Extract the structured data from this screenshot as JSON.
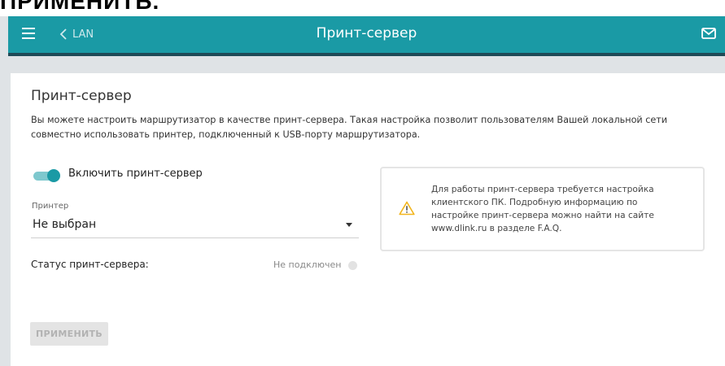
{
  "top_strip": {
    "text": "ПРИМЕНИТЬ."
  },
  "header": {
    "back_label": "LAN",
    "title": "Принт-сервер"
  },
  "page": {
    "title": "Принт-сервер",
    "description": "Вы можете настроить маршрутизатор в качестве принт-сервера. Такая настройка позволит пользователям Вашей локальной сети совместно использовать принтер, подключенный к USB-порту маршрутизатора."
  },
  "toggle": {
    "label": "Включить принт-сервер",
    "enabled": true
  },
  "printer": {
    "label": "Принтер",
    "selected": "Не выбран"
  },
  "status": {
    "label": "Статус принт-сервера:",
    "value": "Не подключен"
  },
  "info": {
    "text": "Для работы принт-сервера требуется настройка клиентского ПК. Подробную информацию по настройке принт-сервера можно найти на сайте www.dlink.ru в разделе F.A.Q."
  },
  "buttons": {
    "apply_label": "ПРИМЕНИТЬ"
  },
  "icons": {
    "menu": "hamburger-icon",
    "back": "chevron-left-icon",
    "mail": "mail-icon",
    "warning": "warning-icon",
    "dropdown": "caret-down-icon"
  },
  "colors": {
    "accent": "#1a9aa5",
    "header_shadow": "#1f4a57",
    "background": "#dfe3e6",
    "warning": "#f2b51d"
  }
}
